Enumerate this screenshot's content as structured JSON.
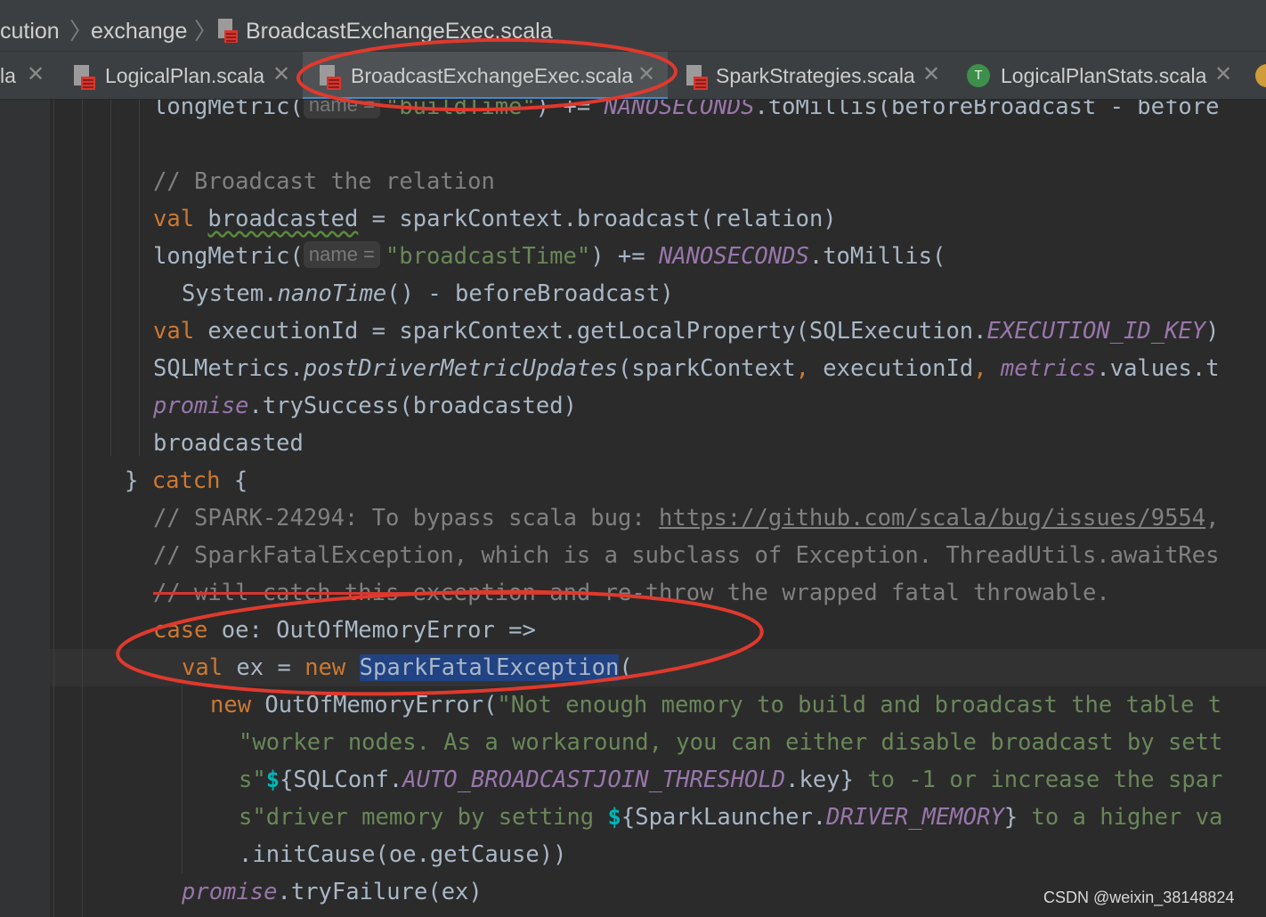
{
  "breadcrumb": {
    "parts": [
      "cution",
      "exchange",
      "BroadcastExchangeExec.scala"
    ]
  },
  "tabs": [
    {
      "label": "la",
      "icon": "scala-file-icon",
      "active": false
    },
    {
      "label": "LogicalPlan.scala",
      "icon": "scala-file-icon",
      "active": false
    },
    {
      "label": "BroadcastExchangeExec.scala",
      "icon": "scala-file-icon",
      "active": true
    },
    {
      "label": "SparkStrategies.scala",
      "icon": "scala-file-icon",
      "active": false
    },
    {
      "label": "LogicalPlanStats.scala",
      "icon": "scala-trait-icon",
      "active": false
    }
  ],
  "tab_close_glyph": "✕",
  "trait_badge": "T",
  "code": {
    "l0_pre": "longMetric(",
    "l0_hint": "name =",
    "l0_str": "\"buildTime\"",
    "l0_mid": ") += ",
    "l0_const": "NANOSECONDS",
    "l0_post": ".toMillis(beforeBroadcast - before",
    "l2_comment": "// Broadcast the relation",
    "l3_kw": "val",
    "l3_var": "broadcasted",
    "l3_post": " = sparkContext.broadcast(relation)",
    "l4_pre": "longMetric(",
    "l4_hint": "name =",
    "l4_str": "\"broadcastTime\"",
    "l4_mid": ") += ",
    "l4_const": "NANOSECONDS",
    "l4_post": ".toMillis(",
    "l5_pre": "System.",
    "l5_it": "nanoTime",
    "l5_post": "() - beforeBroadcast)",
    "l6_kw": "val",
    "l6_pre": " executionId = sparkContext.getLocalProperty(SQLExecution.",
    "l6_const": "EXECUTION_ID_KEY",
    "l6_post": ")",
    "l7_pre": "SQLMetrics.",
    "l7_it": "postDriverMetricUpdates",
    "l7_mid": "(sparkContext",
    "l7_comma1": ",",
    "l7_mid2": " executionId",
    "l7_comma2": ",",
    "l7_field": "metrics",
    "l7_post": ".values.t",
    "l8_field": "promise",
    "l8_post": ".trySuccess(broadcasted)",
    "l9": "broadcasted",
    "l10_pre": "} ",
    "l10_kw": "catch",
    "l10_post": " {",
    "l11_comment": "// SPARK-24294: To bypass scala bug: ",
    "l11_url": "https://github.com/scala/bug/issues/9554",
    "l11_tail": ",",
    "l12_comment": "// SparkFatalException, which is a subclass of Exception. ThreadUtils.awaitRes",
    "l13_strike": "// will catch this exception and",
    "l13_rest": " re-throw the wrapped fatal throwable.",
    "l14_kw": "case",
    "l14_post": " oe: OutOfMemoryError =>",
    "l15_kw": "val",
    "l15_mid": " ex = ",
    "l15_kw2": "new",
    "l15_sel": "SparkFatalException",
    "l15_post": "(",
    "l16_kw": "new",
    "l16_mid": " OutOfMemoryError(",
    "l16_str": "\"Not enough memory to build and broadcast the table t",
    "l17_str": "\"worker nodes. As a workaround, you can either disable broadcast by sett",
    "l18_s": "s\"",
    "l18_d": "$",
    "l18_b1": "{SQLConf.",
    "l18_const": "AUTO_BROADCASTJOIN_THRESHOLD",
    "l18_b2": ".key}",
    "l18_str": " to -1 or increase the spar",
    "l19_s": "s\"driver memory by setting ",
    "l19_d": "$",
    "l19_b1": "{SparkLauncher.",
    "l19_const": "DRIVER_MEMORY",
    "l19_b2": "}",
    "l19_str": " to a higher va",
    "l20": ".initCause(oe.getCause))",
    "l21_field": "promise",
    "l21_post": ".tryFailure(ex)"
  },
  "watermark": "CSDN @weixin_38148824",
  "colors": {
    "background": "#2b2b2b",
    "keyword": "#cc7832",
    "string": "#6a8759",
    "comment": "#808080",
    "constant": "#9876aa",
    "annotation_red": "#e0392d",
    "selection": "#214283"
  }
}
